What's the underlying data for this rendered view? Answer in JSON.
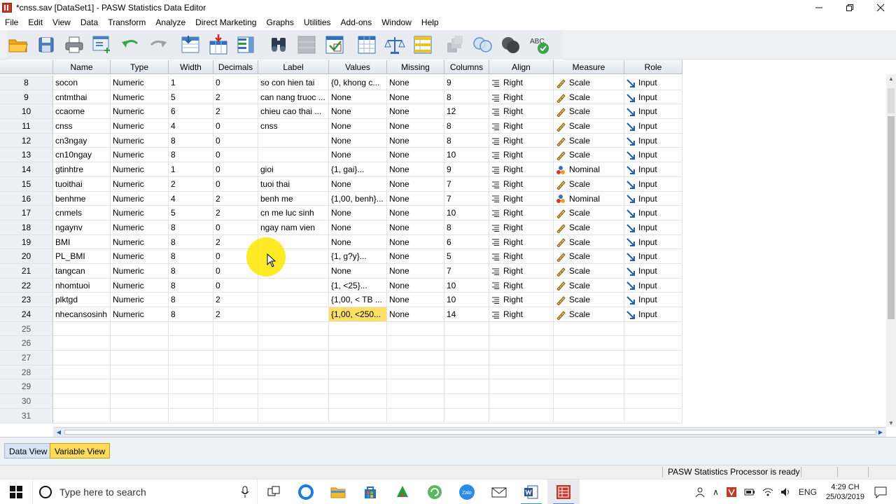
{
  "window": {
    "title": "*cnss.sav [DataSet1] - PASW Statistics Data Editor",
    "controls": [
      "minimize",
      "restore",
      "close"
    ]
  },
  "menu": [
    {
      "label": "File"
    },
    {
      "label": "Edit"
    },
    {
      "label": "View"
    },
    {
      "label": "Data"
    },
    {
      "label": "Transform"
    },
    {
      "label": "Analyze"
    },
    {
      "label": "Direct Marketing"
    },
    {
      "label": "Graphs"
    },
    {
      "label": "Utilities"
    },
    {
      "label": "Add-ons"
    },
    {
      "label": "Window"
    },
    {
      "label": "Help"
    }
  ],
  "toolbar": {
    "icons": [
      "open-folder-icon",
      "save-icon",
      "print-icon",
      "dialog-recall-icon",
      "undo-icon",
      "redo-icon",
      "goto-case-icon",
      "goto-variable-icon",
      "variables-icon",
      "find-icon",
      "insert-cases-icon",
      "insert-variable-icon",
      "split-file-icon",
      "weight-cases-icon",
      "select-cases-icon",
      "value-labels-icon",
      "use-sets-icon",
      "show-all-variables-icon",
      "spell-check-icon"
    ],
    "spell_label": "ABC"
  },
  "grid": {
    "columns": [
      "Name",
      "Type",
      "Width",
      "Decimals",
      "Label",
      "Values",
      "Missing",
      "Columns",
      "Align",
      "Measure",
      "Role"
    ],
    "rows": [
      {
        "num": "8",
        "name": "socon",
        "type": "Numeric",
        "width": "1",
        "decimals": "0",
        "label": "so con hien tai",
        "values": "{0, khong c...",
        "missing": "None",
        "columns": "9",
        "align": "Right",
        "measure": "Scale",
        "role": "Input"
      },
      {
        "num": "9",
        "name": "cntmthai",
        "type": "Numeric",
        "width": "5",
        "decimals": "2",
        "label": "can nang truoc ...",
        "values": "None",
        "missing": "None",
        "columns": "8",
        "align": "Right",
        "measure": "Scale",
        "role": "Input"
      },
      {
        "num": "10",
        "name": "ccaome",
        "type": "Numeric",
        "width": "6",
        "decimals": "2",
        "label": "chieu cao thai ...",
        "values": "None",
        "missing": "None",
        "columns": "12",
        "align": "Right",
        "measure": "Scale",
        "role": "Input"
      },
      {
        "num": "11",
        "name": "cnss",
        "type": "Numeric",
        "width": "4",
        "decimals": "0",
        "label": "cnss",
        "values": "None",
        "missing": "None",
        "columns": "8",
        "align": "Right",
        "measure": "Scale",
        "role": "Input"
      },
      {
        "num": "12",
        "name": "cn3ngay",
        "type": "Numeric",
        "width": "8",
        "decimals": "0",
        "label": "",
        "values": "None",
        "missing": "None",
        "columns": "8",
        "align": "Right",
        "measure": "Scale",
        "role": "Input"
      },
      {
        "num": "13",
        "name": "cn10ngay",
        "type": "Numeric",
        "width": "8",
        "decimals": "0",
        "label": "",
        "values": "None",
        "missing": "None",
        "columns": "10",
        "align": "Right",
        "measure": "Scale",
        "role": "Input"
      },
      {
        "num": "14",
        "name": "gtinhtre",
        "type": "Numeric",
        "width": "1",
        "decimals": "0",
        "label": "gioi",
        "values": "{1, gai}...",
        "missing": "None",
        "columns": "9",
        "align": "Right",
        "measure": "Nominal",
        "role": "Input"
      },
      {
        "num": "15",
        "name": "tuoithai",
        "type": "Numeric",
        "width": "2",
        "decimals": "0",
        "label": "tuoi thai",
        "values": "None",
        "missing": "None",
        "columns": "7",
        "align": "Right",
        "measure": "Scale",
        "role": "Input"
      },
      {
        "num": "16",
        "name": "benhme",
        "type": "Numeric",
        "width": "4",
        "decimals": "2",
        "label": "benh me",
        "values": "{1,00, benh}...",
        "missing": "None",
        "columns": "7",
        "align": "Right",
        "measure": "Nominal",
        "role": "Input"
      },
      {
        "num": "17",
        "name": "cnmels",
        "type": "Numeric",
        "width": "5",
        "decimals": "2",
        "label": "cn me luc sinh",
        "values": "None",
        "missing": "None",
        "columns": "10",
        "align": "Right",
        "measure": "Scale",
        "role": "Input"
      },
      {
        "num": "18",
        "name": "ngaynv",
        "type": "Numeric",
        "width": "8",
        "decimals": "0",
        "label": "ngay nam vien",
        "values": "None",
        "missing": "None",
        "columns": "8",
        "align": "Right",
        "measure": "Scale",
        "role": "Input"
      },
      {
        "num": "19",
        "name": "BMI",
        "type": "Numeric",
        "width": "8",
        "decimals": "2",
        "label": "",
        "values": "None",
        "missing": "None",
        "columns": "6",
        "align": "Right",
        "measure": "Scale",
        "role": "Input"
      },
      {
        "num": "20",
        "name": "PL_BMI",
        "type": "Numeric",
        "width": "8",
        "decimals": "0",
        "label": "",
        "values": "{1, g?y}...",
        "missing": "None",
        "columns": "5",
        "align": "Right",
        "measure": "Scale",
        "role": "Input"
      },
      {
        "num": "21",
        "name": "tangcan",
        "type": "Numeric",
        "width": "8",
        "decimals": "0",
        "label": "",
        "values": "None",
        "missing": "None",
        "columns": "7",
        "align": "Right",
        "measure": "Scale",
        "role": "Input"
      },
      {
        "num": "22",
        "name": "nhomtuoi",
        "type": "Numeric",
        "width": "8",
        "decimals": "0",
        "label": "",
        "values": "{1, <25}...",
        "missing": "None",
        "columns": "10",
        "align": "Right",
        "measure": "Scale",
        "role": "Input"
      },
      {
        "num": "23",
        "name": "plktgd",
        "type": "Numeric",
        "width": "8",
        "decimals": "2",
        "label": "",
        "values": "{1,00, < TB ...",
        "missing": "None",
        "columns": "10",
        "align": "Right",
        "measure": "Scale",
        "role": "Input"
      },
      {
        "num": "24",
        "name": "nhecansosinh",
        "type": "Numeric",
        "width": "8",
        "decimals": "2",
        "label": "",
        "values": "{1,00, <250...",
        "missing": "None",
        "columns": "14",
        "align": "Right",
        "measure": "Scale",
        "role": "Input",
        "selected_field": "values"
      }
    ],
    "empty_rows": [
      "25",
      "26",
      "27",
      "28",
      "29",
      "30",
      "31"
    ]
  },
  "tabs": [
    {
      "label": "Data View",
      "active": false
    },
    {
      "label": "Variable View",
      "active": true
    }
  ],
  "status": {
    "text": "PASW Statistics Processor is ready"
  },
  "taskbar": {
    "search_placeholder": "Type here to search",
    "apps": [
      "task-view-icon",
      "edge-icon",
      "file-explorer-icon",
      "store-icon",
      "app-green-icon",
      "app-refresh-icon",
      "zalo-icon",
      "mail-icon",
      "word-icon",
      "spss-icon"
    ],
    "zalo_label": "Zalo",
    "lang": "ENG",
    "time": "4:29 CH",
    "date": "25/03/2019"
  },
  "colors": {
    "selection": "#ffe066",
    "active_tab": "#ffdc5a",
    "header_bg": "#e2e6ee",
    "scale_icon": "#c8a02e",
    "role_icon": "#1f5fa8"
  }
}
